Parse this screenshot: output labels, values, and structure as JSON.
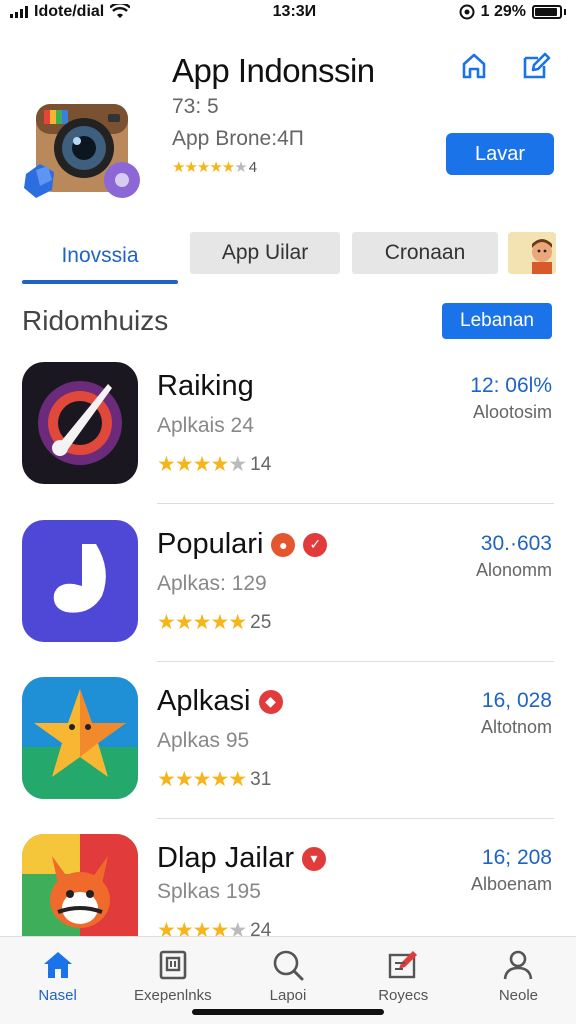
{
  "status": {
    "carrier": "Idote/dial",
    "time": "13:3И",
    "battery": "1 29%"
  },
  "header": {
    "title": "App Indonssin",
    "meta_1": "73: 5",
    "meta_2": "App Brone:4П",
    "rating_count": "4",
    "action_label": "Lavar"
  },
  "tabs": [
    {
      "label": "Inovssia",
      "active": true
    },
    {
      "label": "App Uilar",
      "active": false
    },
    {
      "label": "Cronaan",
      "active": false
    }
  ],
  "section": {
    "title": "Ridomhuizs",
    "button_label": "Lebanan"
  },
  "apps": [
    {
      "name": "Raiking",
      "sub": "Aplkais 24",
      "rating_count": "14",
      "stat": "12: 06l%",
      "stat_label": "Alootosim"
    },
    {
      "name": "Populari",
      "sub": "Aplkas: 129",
      "rating_count": "25",
      "stat": "30.·603",
      "stat_label": "Alonomm"
    },
    {
      "name": "Aplkasi",
      "sub": "Aplkas 95",
      "rating_count": "31",
      "stat": "16, 028",
      "stat_label": "Altotnom"
    },
    {
      "name": "Dlap Jailar",
      "sub": "Splkas 195",
      "rating_count": "24",
      "stat": "16; 208",
      "stat_label": "Alboenam"
    }
  ],
  "nav": [
    {
      "label": "Nasel",
      "icon": "home-icon",
      "active": true
    },
    {
      "label": "Exepenlnks",
      "icon": "library-icon",
      "active": false
    },
    {
      "label": "Lapoi",
      "icon": "search-icon",
      "active": false
    },
    {
      "label": "Royecs",
      "icon": "edit-icon",
      "active": false
    },
    {
      "label": "Neole",
      "icon": "profile-icon",
      "active": false
    }
  ],
  "colors": {
    "accent": "#1a73e8",
    "accent_text": "#1f63c4",
    "star": "#f6b51b"
  }
}
